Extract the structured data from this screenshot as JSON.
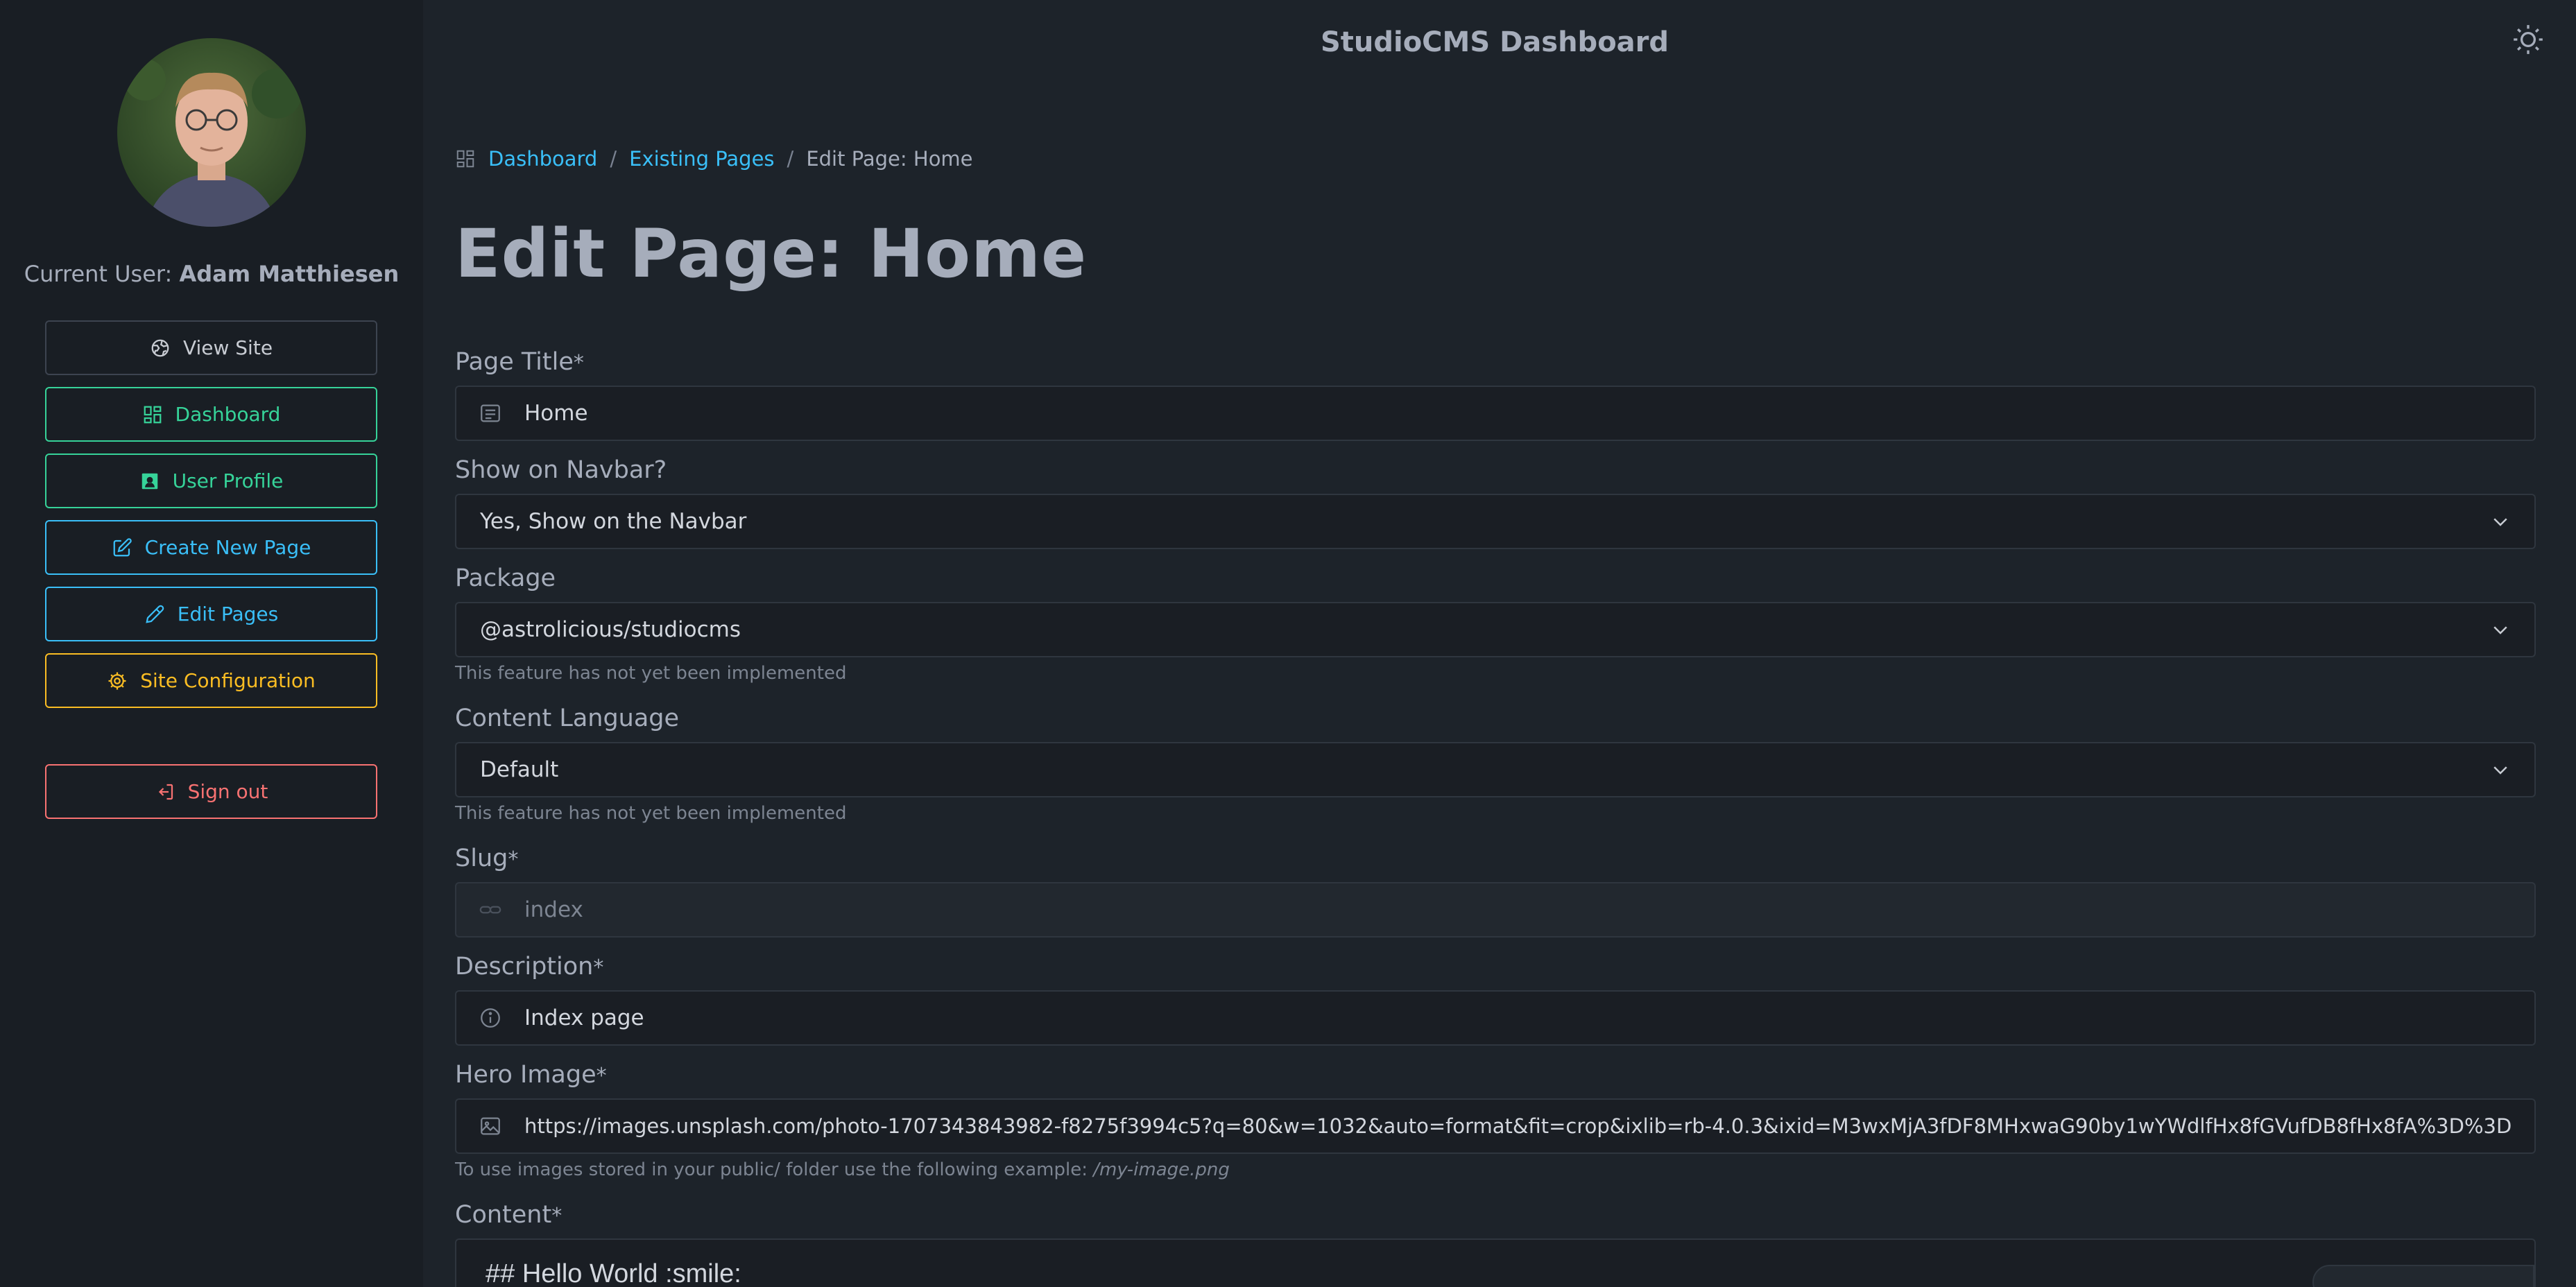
{
  "app_title": "StudioCMS Dashboard",
  "sidebar": {
    "current_user_prefix": "Current User:",
    "current_user_name": "Adam Matthiesen",
    "buttons": {
      "view_site": "View Site",
      "dashboard": "Dashboard",
      "user_profile": "User Profile",
      "create_new_page": "Create New Page",
      "edit_pages": "Edit Pages",
      "site_configuration": "Site Configuration",
      "sign_out": "Sign out"
    }
  },
  "breadcrumb": {
    "items": [
      "Dashboard",
      "Existing Pages"
    ],
    "separator": "/",
    "current": "Edit Page: Home"
  },
  "page_heading": "Edit Page: Home",
  "form": {
    "page_title": {
      "label": "Page Title",
      "required": "*",
      "value": "Home"
    },
    "show_on_navbar": {
      "label": "Show on Navbar?",
      "value": "Yes, Show on the Navbar"
    },
    "package": {
      "label": "Package",
      "value": "@astrolicious/studiocms",
      "hint": "This feature has not yet been implemented"
    },
    "content_language": {
      "label": "Content Language",
      "value": "Default",
      "hint": "This feature has not yet been implemented"
    },
    "slug": {
      "label": "Slug",
      "required": "*",
      "value": "index"
    },
    "description": {
      "label": "Description",
      "required": "*",
      "value": "Index page"
    },
    "hero_image": {
      "label": "Hero Image",
      "required": "*",
      "value": "https://images.unsplash.com/photo-1707343843982-f8275f3994c5?q=80&w=1032&auto=format&fit=crop&ixlib=rb-4.0.3&ixid=M3wxMjA3fDF8MHxwaG90by1wYWdlfHx8fGVufDB8fHx8fA%3D%3D",
      "hint_prefix": "To use images stored in your public/ folder use the following example:",
      "hint_example": "/my-image.png"
    },
    "content": {
      "label": "Content",
      "required": "*",
      "value": "## Hello World :smile:"
    }
  },
  "colors": {
    "background": "#1d232a",
    "sidebar": "#191e24",
    "success": "#36d399",
    "info": "#3abff8",
    "warning": "#fbbd23",
    "error": "#f87272"
  },
  "icons": {
    "view_site": "globe-icon",
    "dashboard": "dashboard-grid-icon",
    "user_profile": "user-square-icon",
    "create_new_page": "pencil-square-icon",
    "edit_pages": "pencil-icon",
    "site_configuration": "gear-icon",
    "sign_out": "logout-icon",
    "theme": "sun-icon"
  }
}
